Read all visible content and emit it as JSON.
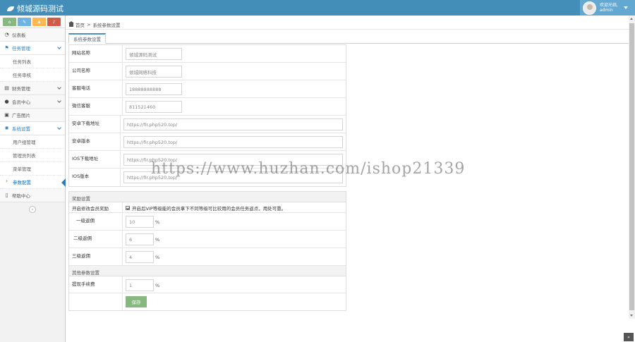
{
  "app": {
    "title": "倾城源码测试"
  },
  "user": {
    "welcome": "欢迎光临,",
    "name": "admin"
  },
  "colors": {
    "topbar": "#438eb9",
    "accent": "#2b7dbc",
    "save": "#87b87f"
  },
  "shortcuts": [
    {
      "icon": "home-icon",
      "glyph": "⌂"
    },
    {
      "icon": "pencil-icon",
      "glyph": "✎"
    },
    {
      "icon": "users-icon",
      "glyph": "♟"
    },
    {
      "icon": "bell-icon",
      "glyph": "♪"
    }
  ],
  "sidebar": {
    "items": [
      {
        "label": "仪表板",
        "icon": "dashboard-icon",
        "glyph": "◔"
      },
      {
        "label": "任务管理",
        "icon": "flag-icon",
        "glyph": "⚑"
      },
      {
        "label": "财务管理",
        "icon": "wallet-icon",
        "glyph": "▤"
      },
      {
        "label": "会员中心",
        "icon": "user-icon",
        "glyph": "●"
      },
      {
        "label": "广告图片",
        "icon": "picture-icon",
        "glyph": "▣"
      },
      {
        "label": "系统设置",
        "icon": "gear-icon",
        "glyph": "✺"
      },
      {
        "label": "帮助中心",
        "icon": "bookmark-icon",
        "glyph": "▯"
      }
    ],
    "task_sub": [
      "任务列表",
      "任务审核"
    ],
    "system_sub": [
      "用户组管理",
      "管理员列表",
      "菜单管理",
      "参数配置"
    ]
  },
  "breadcrumb": {
    "home": "首页",
    "current": "系统参数设置"
  },
  "tab": {
    "label": "系统参数设置"
  },
  "basic_fields": [
    {
      "label": "网站名称",
      "value": "倾城源码测试",
      "size": "short"
    },
    {
      "label": "公司名称",
      "value": "倾城网络科技",
      "size": "short"
    },
    {
      "label": "客服电话",
      "value": "18888888888",
      "size": "short"
    },
    {
      "label": "微信客服",
      "value": "811521460",
      "size": "short"
    },
    {
      "label": "安卓下载地址",
      "value": "https://fir.php520.top/",
      "size": "long"
    },
    {
      "label": "安卓版本",
      "value": "https://fir.php520.top/",
      "size": "long"
    },
    {
      "label": "IOS下载地址",
      "value": "https://fir.php520.top/",
      "size": "long"
    },
    {
      "label": "IOS版本",
      "value": "https://fir.php520.top/",
      "size": "long"
    }
  ],
  "rebate": {
    "section": "奖励设置",
    "toggle_label": "开启修改会员奖励",
    "toggle_text": "开启后VIP等级能的会员拿下不同等级可比较用的会员任务返点，用处可靠。",
    "levels": [
      {
        "label": "一级返佣",
        "value": "10"
      },
      {
        "label": "二级返佣",
        "value": "6"
      },
      {
        "label": "三级返佣",
        "value": "4"
      }
    ],
    "pct": "%"
  },
  "withdraw": {
    "section": "其他参数设置",
    "fee_label": "提现手续费",
    "fee_value": "1",
    "pct": "%",
    "save": "保存"
  },
  "watermark": "https://www.huzhan.com/ishop21339"
}
